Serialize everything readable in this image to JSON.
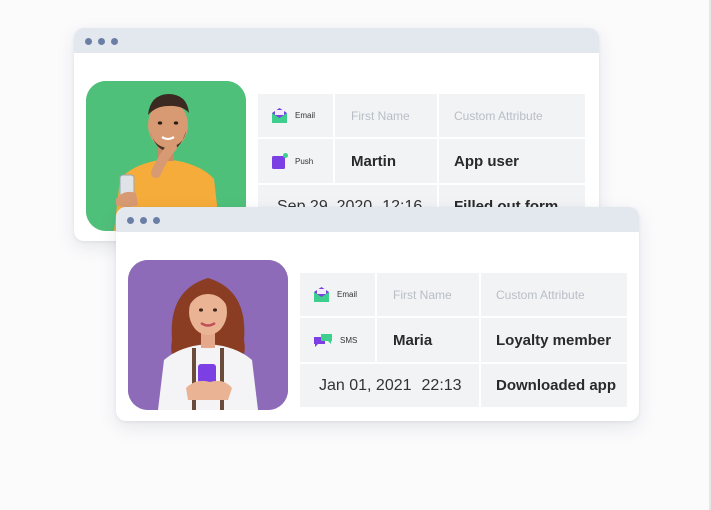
{
  "back_card": {
    "headers": {
      "channel_label": "Email",
      "first_name": "First Name",
      "custom_attribute": "Custom Attribute"
    },
    "row1": {
      "channel_label": "Push",
      "first_name": "Martin",
      "custom_attribute": "App user"
    },
    "row2": {
      "date": "Sep 29, 2020",
      "time": "12:16",
      "event": "Filled out form"
    },
    "colors": {
      "photo_bg": "#4fc07a"
    }
  },
  "front_card": {
    "headers": {
      "channel_label": "Email",
      "first_name": "First Name",
      "custom_attribute": "Custom Attribute"
    },
    "row1": {
      "channel_label": "SMS",
      "first_name": "Maria",
      "custom_attribute": "Loyalty member"
    },
    "row2": {
      "date": "Jan 01, 2021",
      "time": "22:13",
      "event": "Downloaded app"
    },
    "colors": {
      "photo_bg": "#8d6bb8"
    }
  },
  "icons": {
    "email": "envelope-icon",
    "push": "push-notification-icon",
    "sms": "chat-bubbles-icon"
  },
  "colors": {
    "titlebar": "#e3e8ef",
    "window_dot": "#6b7fa6",
    "cell_bg": "#f1f3f5",
    "email_green": "#3ecf8e",
    "brand_purple": "#7b3fe4"
  }
}
